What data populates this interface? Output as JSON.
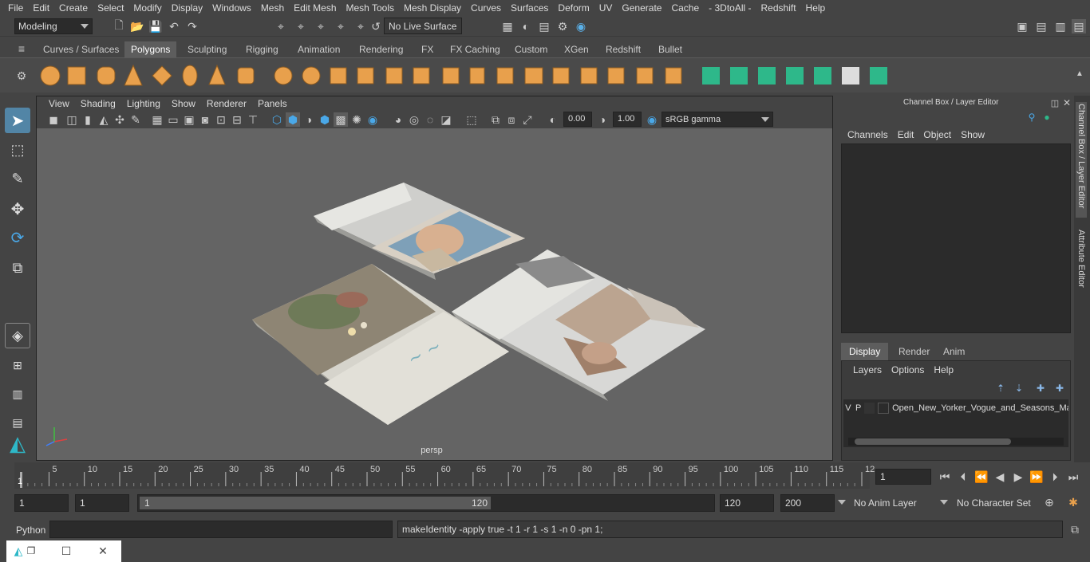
{
  "menubar": [
    "File",
    "Edit",
    "Create",
    "Select",
    "Modify",
    "Display",
    "Windows",
    "Mesh",
    "Edit Mesh",
    "Mesh Tools",
    "Mesh Display",
    "Curves",
    "Surfaces",
    "Deform",
    "UV",
    "Generate",
    "Cache",
    "- 3DtoAll -",
    "Redshift",
    "Help"
  ],
  "status": {
    "mode": "Modeling",
    "live_surface": "No Live Surface"
  },
  "shelf_tabs": [
    "Curves / Surfaces",
    "Polygons",
    "Sculpting",
    "Rigging",
    "Animation",
    "Rendering",
    "FX",
    "FX Caching",
    "Custom",
    "XGen",
    "Redshift",
    "Bullet"
  ],
  "shelf_active": "Polygons",
  "viewport": {
    "menu": [
      "View",
      "Shading",
      "Lighting",
      "Show",
      "Renderer",
      "Panels"
    ],
    "exposure": "0.00",
    "gamma": "1.00",
    "colorspace": "sRGB gamma",
    "camera": "persp"
  },
  "channel_box": {
    "title": "Channel Box / Layer Editor",
    "menu": [
      "Channels",
      "Edit",
      "Object",
      "Show"
    ],
    "layer_tabs": [
      "Display",
      "Render",
      "Anim"
    ],
    "layer_active": "Display",
    "layer_menu": [
      "Layers",
      "Options",
      "Help"
    ],
    "layer": {
      "v": "V",
      "p": "P",
      "name": "Open_New_Yorker_Vogue_and_Seasons_Ma"
    }
  },
  "side_tabs": [
    "Channel Box / Layer Editor",
    "Attribute Editor"
  ],
  "timeline": {
    "ticks": [
      "5",
      "10",
      "15",
      "20",
      "25",
      "30",
      "35",
      "40",
      "45",
      "50",
      "55",
      "60",
      "65",
      "70",
      "75",
      "80",
      "85",
      "90",
      "95",
      "100",
      "105",
      "110",
      "115",
      "12"
    ],
    "start_label": "1",
    "current_frame": "1"
  },
  "range": {
    "start": "1",
    "start2": "1",
    "slider_start": "1",
    "slider_end": "120",
    "end": "120",
    "end2": "200",
    "anim_layer": "No Anim Layer",
    "char_set": "No Character Set"
  },
  "cmdline": {
    "lang": "Python",
    "result": "makeIdentity -apply true -t 1 -r 1 -s 1 -n 0 -pn 1;"
  },
  "colors": {
    "accent": "#5285a6",
    "orange": "#e8a04c",
    "green": "#2eb88a"
  }
}
